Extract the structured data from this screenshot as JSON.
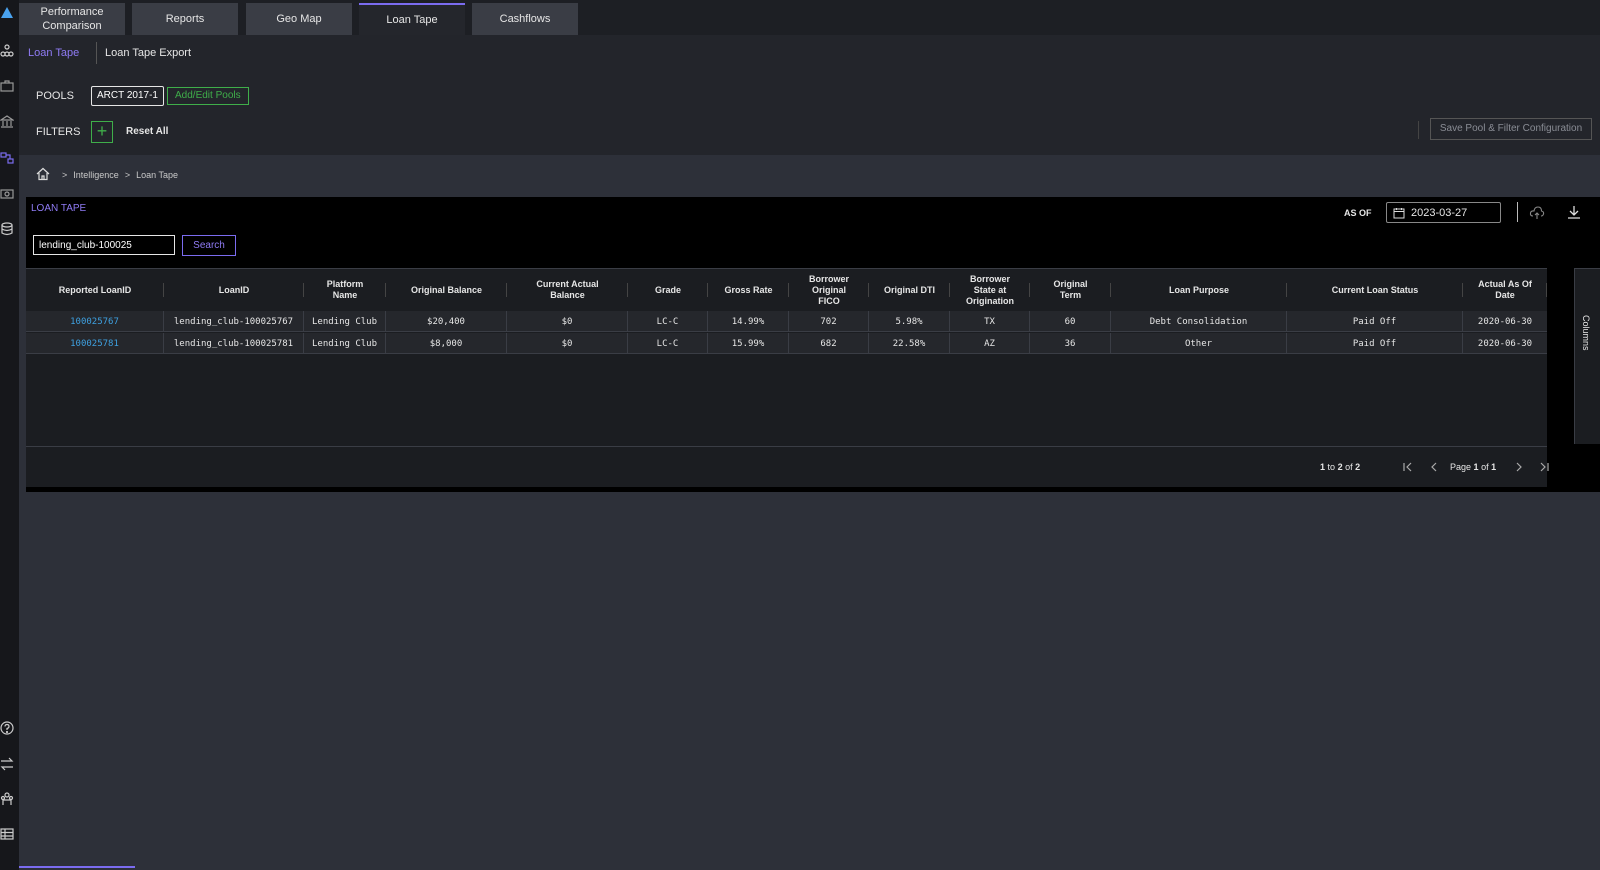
{
  "top_tabs": [
    {
      "label": "Performance Comparison"
    },
    {
      "label": "Reports"
    },
    {
      "label": "Geo Map"
    },
    {
      "label": "Loan Tape"
    },
    {
      "label": "Cashflows"
    }
  ],
  "sub_tabs": {
    "loan_tape": "Loan Tape",
    "export": "Loan Tape Export"
  },
  "pools": {
    "label": "POOLS",
    "selected": "ARCT 2017-1",
    "edit": "Add/Edit Pools"
  },
  "filters": {
    "label": "FILTERS",
    "add_icon": "plus-icon",
    "reset": "Reset All"
  },
  "save_config": "Save Pool & Filter Configuration",
  "breadcrumb": {
    "home_icon": "home-icon",
    "items": [
      "Intelligence",
      "Loan Tape"
    ]
  },
  "panel": {
    "title": "LOAN TAPE",
    "as_of_label": "AS OF",
    "as_of_date": "2023-03-27",
    "search_value": "lending_club-100025",
    "search_button": "Search",
    "columns_label": "Columns"
  },
  "table": {
    "headers": [
      "Reported LoanID",
      "LoanID",
      "Platform Name",
      "Original Balance",
      "Current Actual Balance",
      "Grade",
      "Gross Rate",
      "Borrower Original FICO",
      "Original DTI",
      "Borrower State at Origination",
      "Original Term",
      "Loan Purpose",
      "Current Loan Status",
      "Actual As Of Date"
    ],
    "rows": [
      [
        "100025767",
        "lending_club-100025767",
        "Lending Club",
        "$20,400",
        "$0",
        "LC-C",
        "14.99%",
        "702",
        "5.98%",
        "TX",
        "60",
        "Debt Consolidation",
        "Paid Off",
        "2020-06-30"
      ],
      [
        "100025781",
        "lending_club-100025781",
        "Lending Club",
        "$8,000",
        "$0",
        "LC-C",
        "15.99%",
        "682",
        "22.58%",
        "AZ",
        "36",
        "Other",
        "Paid Off",
        "2020-06-30"
      ]
    ]
  },
  "pagination": {
    "range_from": "1",
    "range_to": "2",
    "total": "2",
    "to_word": "to",
    "of_word": "of",
    "page_word": "Page",
    "page": "1",
    "pages": "1"
  },
  "colors": {
    "accent": "#7b6cf0",
    "green": "#3fae4a",
    "link": "#3ea0e0"
  }
}
